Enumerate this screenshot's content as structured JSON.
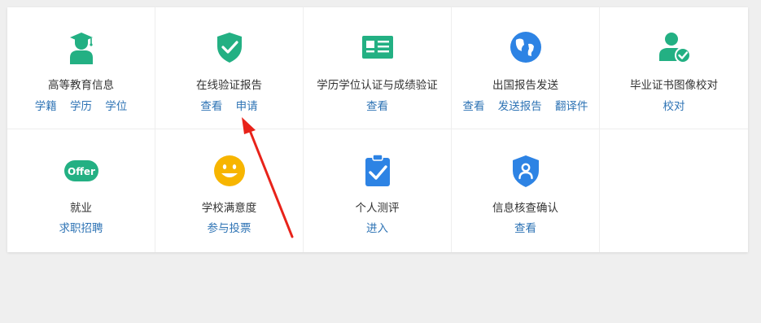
{
  "colors": {
    "green": "#23b083",
    "blue": "#2d83e4",
    "link": "#2f74b5",
    "title_text": "#333333",
    "arrow": "#e8231a"
  },
  "services": [
    {
      "icon": "graduate-icon",
      "title": "高等教育信息",
      "links": [
        "学籍",
        "学历",
        "学位"
      ]
    },
    {
      "icon": "shield-check-icon",
      "title": "在线验证报告",
      "links": [
        "查看",
        "申请"
      ]
    },
    {
      "icon": "id-card-icon",
      "title": "学历学位认证与成绩验证",
      "links": [
        "查看"
      ]
    },
    {
      "icon": "globe-icon",
      "title": "出国报告发送",
      "links": [
        "查看",
        "发送报告",
        "翻译件"
      ]
    },
    {
      "icon": "user-check-icon",
      "title": "毕业证书图像校对",
      "links": [
        "校对"
      ]
    },
    {
      "icon": "offer-icon",
      "icon_text": "Offer",
      "title": "就业",
      "links": [
        "求职招聘"
      ]
    },
    {
      "icon": "smiley-icon",
      "title": "学校满意度",
      "links": [
        "参与投票"
      ]
    },
    {
      "icon": "clipboard-check-icon",
      "title": "个人测评",
      "links": [
        "进入"
      ]
    },
    {
      "icon": "shield-user-icon",
      "title": "信息核查确认",
      "links": [
        "查看"
      ]
    }
  ]
}
